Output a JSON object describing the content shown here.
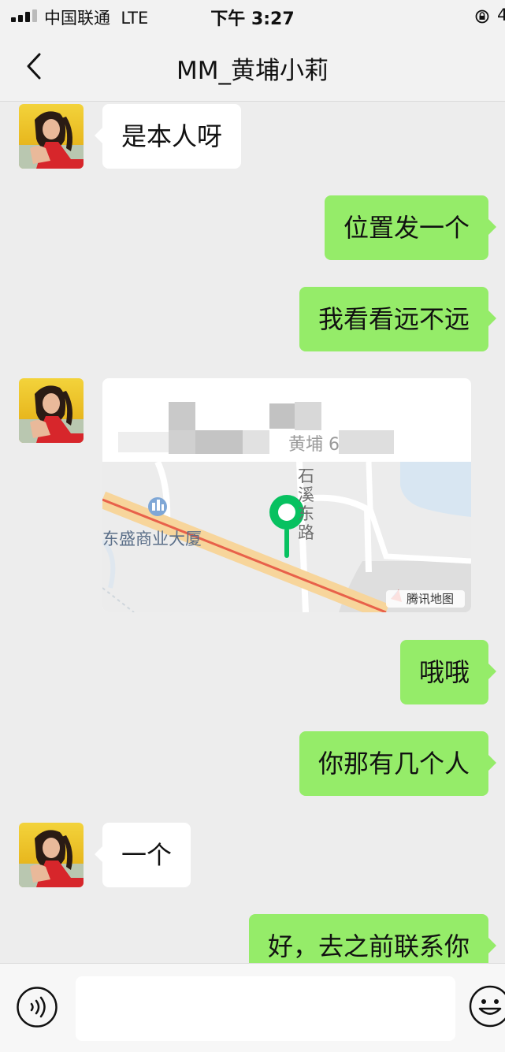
{
  "status_bar": {
    "carrier": "中国联通",
    "network": "LTE",
    "time": "下午 3:27",
    "battery_partial": "4"
  },
  "header": {
    "title": "MM_黄埔小莉",
    "back_icon": "chevron-left-icon"
  },
  "messages": [
    {
      "side": "left",
      "text": "是本人呀"
    },
    {
      "side": "right",
      "text": "位置发一个"
    },
    {
      "side": "right",
      "text": "我看看远不远"
    },
    {
      "side": "left",
      "type": "location",
      "name_visible": "",
      "address_visible": "黄埔 651号",
      "map": {
        "poi": "东盛商业大厦",
        "road": "石溪东路",
        "brand": "腾讯地图"
      }
    },
    {
      "side": "right",
      "text": "哦哦"
    },
    {
      "side": "right",
      "text": "你那有几个人"
    },
    {
      "side": "left",
      "text": "一个"
    },
    {
      "side": "right",
      "text": "好，去之前联系你"
    }
  ],
  "input_bar": {
    "voice_icon": "voice-icon",
    "emoji_icon": "emoji-icon",
    "placeholder": ""
  },
  "colors": {
    "bubble_right": "#95ec69",
    "bubble_left": "#ffffff",
    "background": "#ededed",
    "pin": "#07c160"
  }
}
